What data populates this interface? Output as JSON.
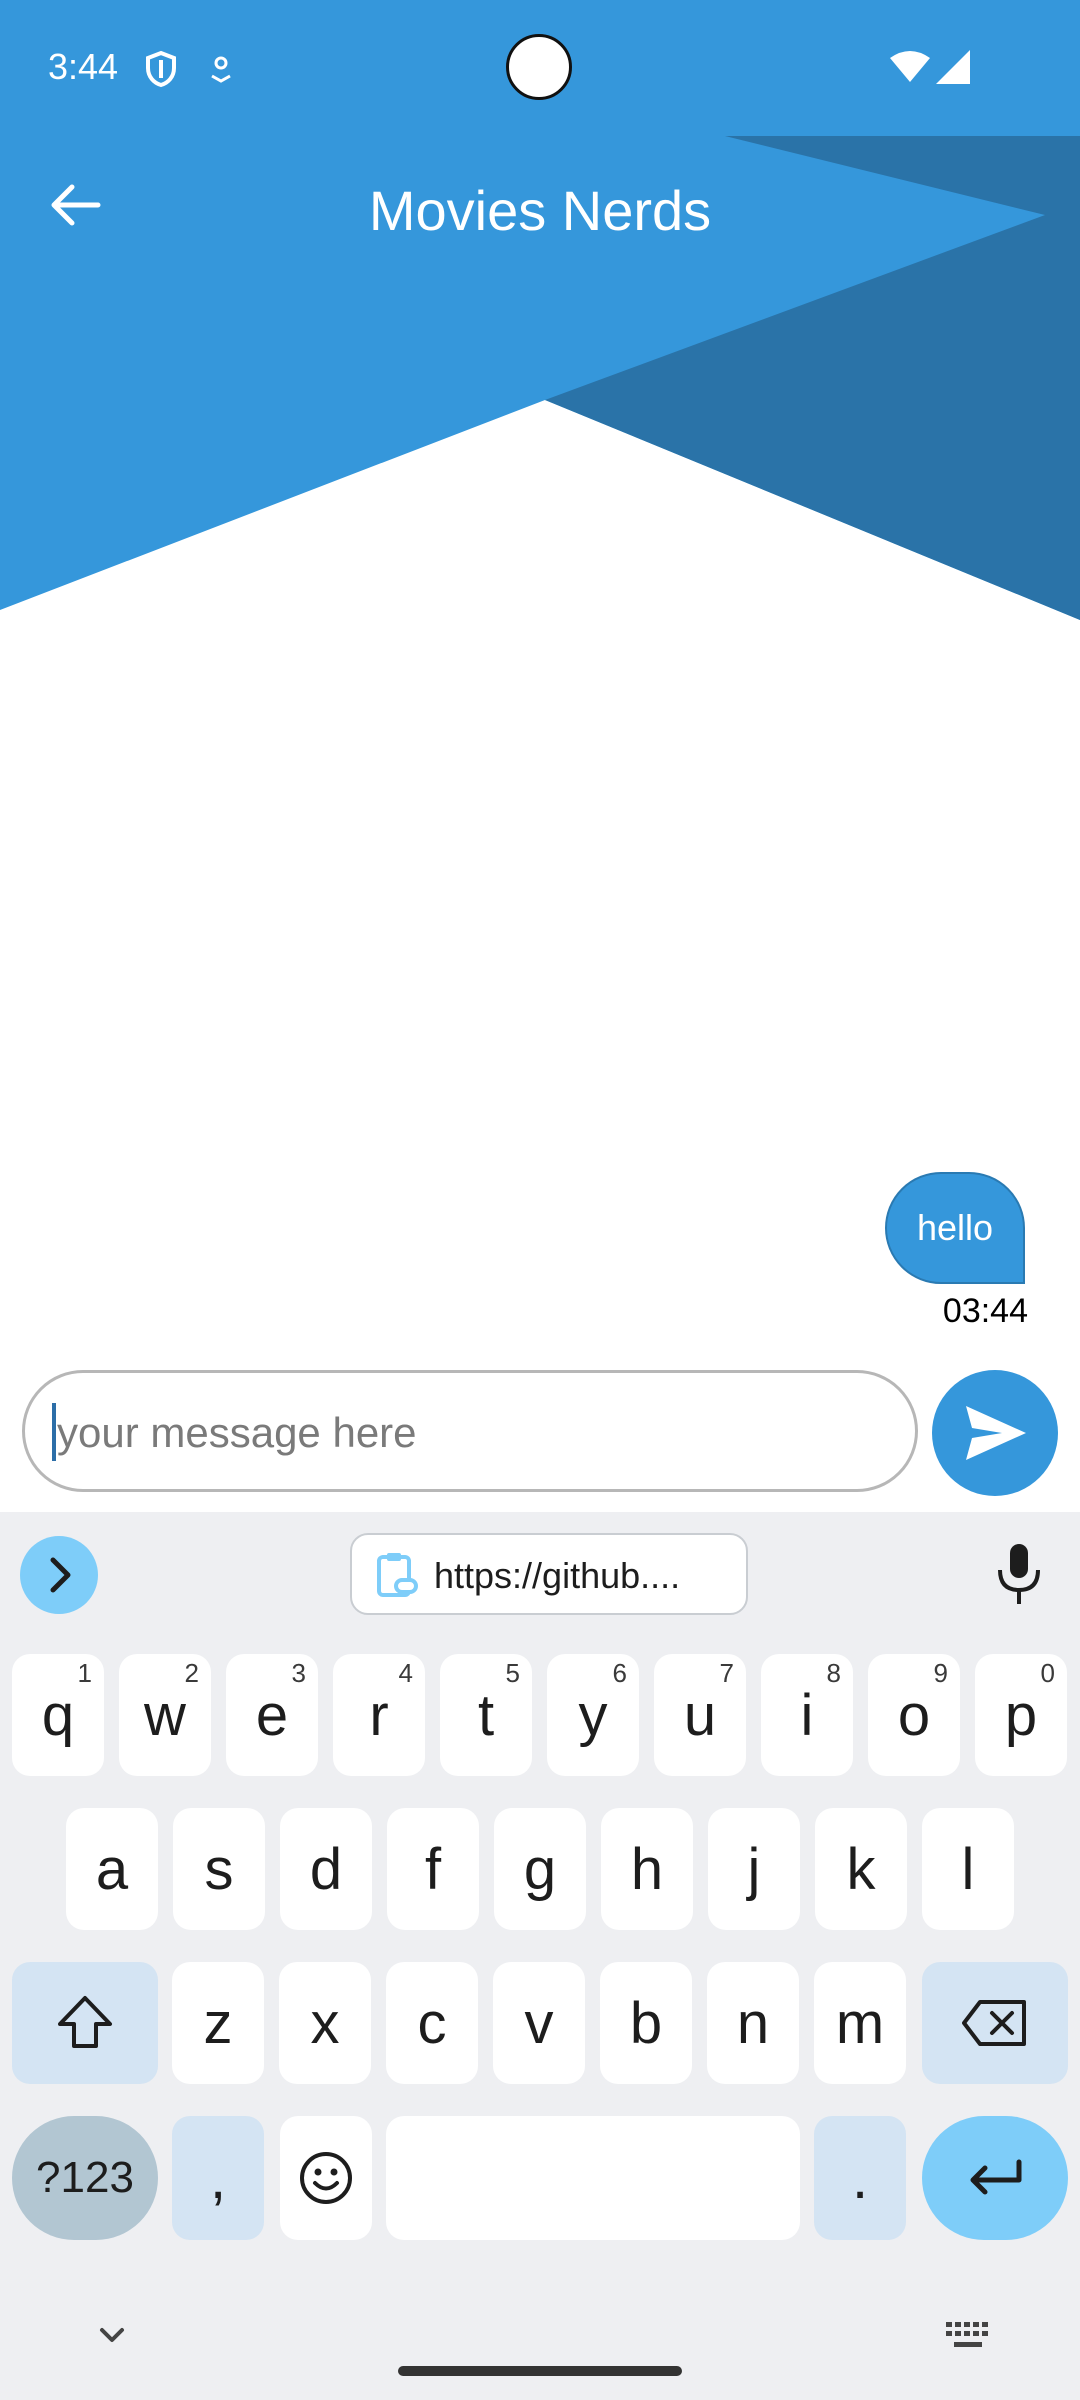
{
  "status_bar": {
    "time": "3:44",
    "icons": [
      "shield-icon",
      "location-icon",
      "wifi-icon",
      "signal-icon"
    ]
  },
  "header": {
    "title": "Movies Nerds",
    "back_icon": "arrow-left-icon"
  },
  "colors": {
    "primary": "#3597db",
    "primary_dark": "#2a73a8",
    "keyboard_bg": "#eeeff2",
    "key_modifier": "#d4e4f3",
    "accent_key": "#7ecdf9"
  },
  "messages": [
    {
      "text": "hello",
      "time": "03:44",
      "outgoing": true
    }
  ],
  "composer": {
    "placeholder": "your message here",
    "value": "",
    "send_icon": "send-icon"
  },
  "keyboard": {
    "suggestion_bar": {
      "expand_icon": "chevron-right-icon",
      "clipboard_text": "https://github....",
      "clipboard_icon": "clipboard-link-icon",
      "mic_icon": "microphone-icon"
    },
    "row1": [
      {
        "label": "q",
        "hint": "1"
      },
      {
        "label": "w",
        "hint": "2"
      },
      {
        "label": "e",
        "hint": "3"
      },
      {
        "label": "r",
        "hint": "4"
      },
      {
        "label": "t",
        "hint": "5"
      },
      {
        "label": "y",
        "hint": "6"
      },
      {
        "label": "u",
        "hint": "7"
      },
      {
        "label": "i",
        "hint": "8"
      },
      {
        "label": "o",
        "hint": "9"
      },
      {
        "label": "p",
        "hint": "0"
      }
    ],
    "row2": [
      "a",
      "s",
      "d",
      "f",
      "g",
      "h",
      "j",
      "k",
      "l"
    ],
    "row3": [
      "z",
      "x",
      "c",
      "v",
      "b",
      "n",
      "m"
    ],
    "bottom": {
      "symbols": "?123",
      "comma": ",",
      "period": ".",
      "emoji_icon": "emoji-icon",
      "enter_icon": "enter-icon"
    },
    "nav": {
      "hide_icon": "chevron-down-icon",
      "switch_icon": "keyboard-icon"
    }
  }
}
